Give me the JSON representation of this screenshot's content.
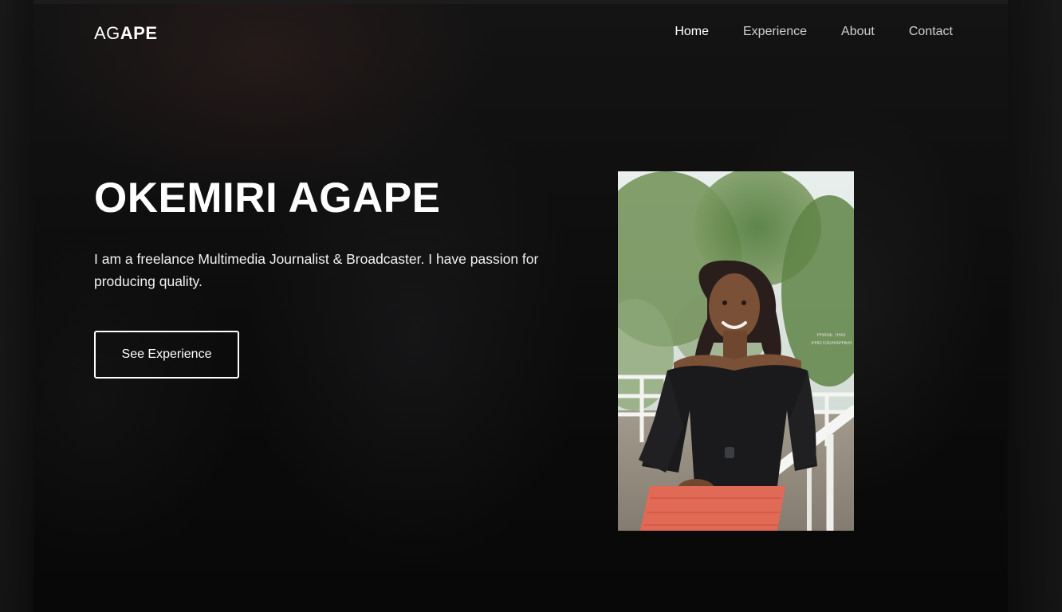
{
  "header": {
    "logo_light": "AG",
    "logo_bold": "APE",
    "nav": [
      {
        "label": "Home",
        "active": true
      },
      {
        "label": "Experience",
        "active": false
      },
      {
        "label": "About",
        "active": false
      },
      {
        "label": "Contact",
        "active": false
      }
    ]
  },
  "hero": {
    "title": "OKEMIRI AGAPE",
    "description": "I am a freelance Multimedia Journalist & Broadcaster. I have passion for producing quality.",
    "cta_label": "See Experience"
  },
  "portrait": {
    "watermark_line1": "PHASE THAT",
    "watermark_line2": "PHOTOGRAPHER"
  },
  "colors": {
    "background": "#0b0b0b",
    "text": "#ffffff",
    "nav_inactive": "#cfcfcf",
    "skirt": "#e06a55",
    "top": "#1a1a1c"
  }
}
